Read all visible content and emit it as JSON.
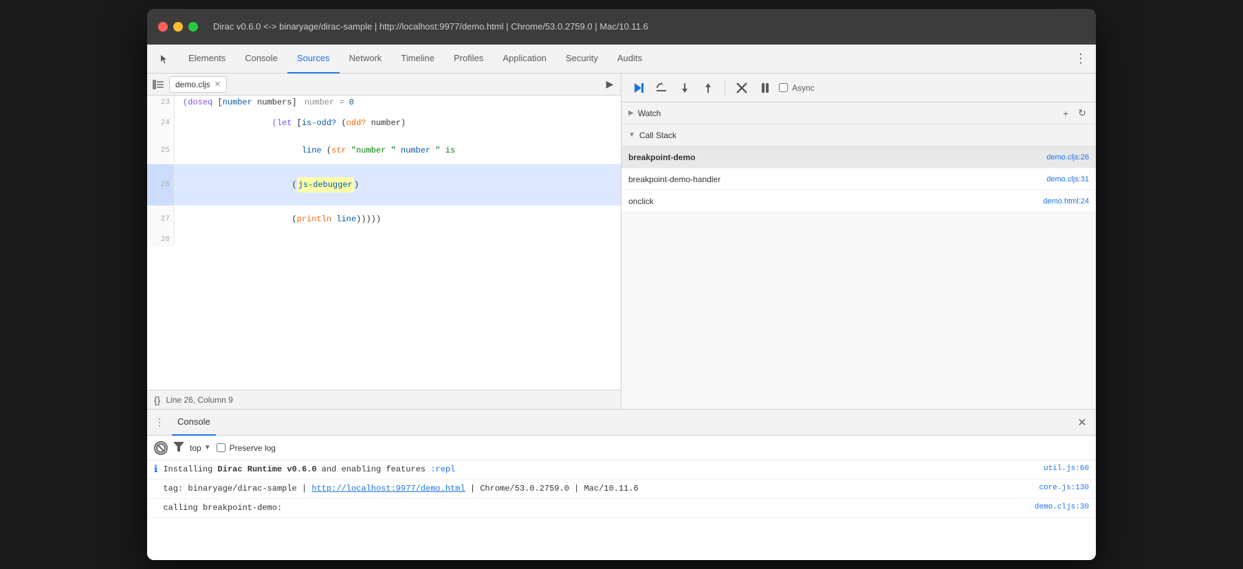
{
  "window": {
    "title": "Dirac v0.6.0 <-> binaryage/dirac-sample | http://localhost:9977/demo.html | Chrome/53.0.2759.0 | Mac/10.11.6"
  },
  "toolbar": {
    "tabs": [
      "Elements",
      "Console",
      "Sources",
      "Network",
      "Timeline",
      "Profiles",
      "Application",
      "Security",
      "Audits"
    ],
    "active_tab": "Sources"
  },
  "sources": {
    "file_tab": "demo.cljs",
    "status_bar": "Line 26, Column 9",
    "code_lines": [
      {
        "number": "23",
        "content": "  (doseq [number numbers]  number = 0",
        "highlight": false
      },
      {
        "number": "24",
        "content": "    (let [is-odd? (odd? number)",
        "highlight": false
      },
      {
        "number": "25",
        "content": "          line (str \"number \" number \" is",
        "highlight": false
      },
      {
        "number": "26",
        "content": "      (js-debugger)",
        "highlight": true
      },
      {
        "number": "27",
        "content": "      (println line)))))",
        "highlight": false
      },
      {
        "number": "28",
        "content": "",
        "highlight": false
      }
    ]
  },
  "debugger": {
    "watch_label": "Watch",
    "callstack_label": "Call Stack",
    "async_label": "Async",
    "callstack_items": [
      {
        "name": "breakpoint-demo",
        "location": "demo.cljs:26",
        "bold": true
      },
      {
        "name": "breakpoint-demo-handler",
        "location": "demo.cljs:31",
        "bold": false
      },
      {
        "name": "onclick",
        "location": "demo.html:24",
        "bold": false
      }
    ]
  },
  "console": {
    "tab_label": "Console",
    "filter": {
      "top_label": "top",
      "preserve_label": "Preserve log"
    },
    "lines": [
      {
        "type": "info",
        "text_parts": [
          "Installing ",
          "Dirac Runtime v0.6.0",
          " and enabling features ",
          ":repl"
        ],
        "source": "util.js:60"
      },
      {
        "type": "text",
        "text": "tag: binaryage/dirac-sample | http://localhost:9977/demo.html | Chrome/53.0.2759.0 | Mac/10.11.6",
        "link": "http://localhost:9977/demo.html",
        "source": "core.js:130"
      },
      {
        "type": "text",
        "text": "calling breakpoint-demo:",
        "source": "demo.cljs:30"
      }
    ]
  }
}
